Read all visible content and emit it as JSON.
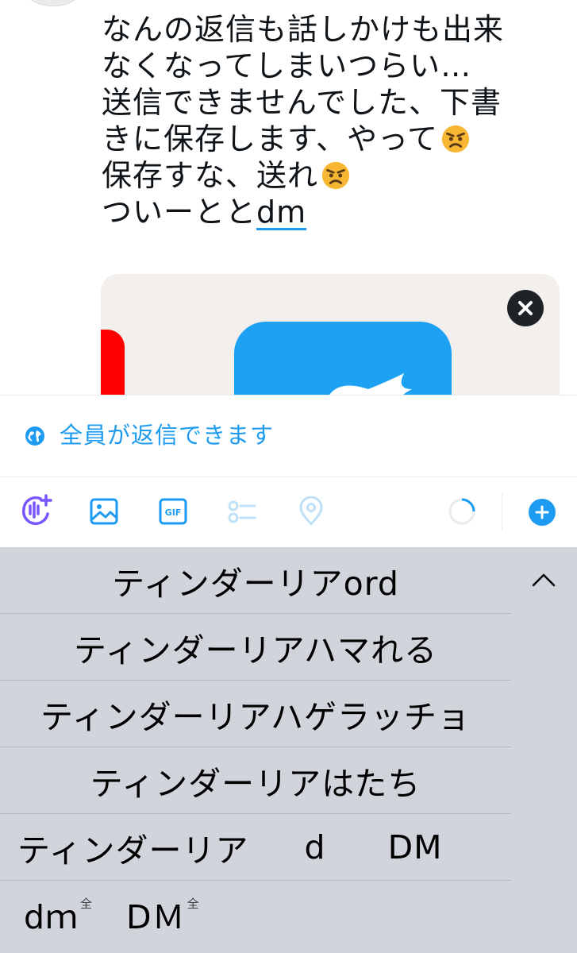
{
  "compose": {
    "lines": [
      {
        "text": "なんの返信も話しかけも出来",
        "emoji": ""
      },
      {
        "text": "なくなってしまいつらい…",
        "emoji": ""
      },
      {
        "text": "送信できませんでした、下書",
        "emoji": ""
      },
      {
        "text": "きに保存します、やって",
        "emoji": "angry-face-emoji"
      },
      {
        "text": "保存すな、送れ",
        "emoji": "angry-face-emoji"
      }
    ],
    "last_line_prefix": "ついーとと",
    "last_line_underlined": "dm"
  },
  "reply_settings": {
    "icon": "globe-icon",
    "label": "全員が返信できます"
  },
  "toolbar": {
    "icons": [
      "voice-tweet-icon",
      "image-icon",
      "gif-icon",
      "poll-icon",
      "location-icon",
      "character-counter",
      "add-tweet-icon"
    ],
    "gif_label": "GIF",
    "accent_color": "#1d9bf0",
    "disabled_color": "#bfe0f7",
    "voice_color": "#7856ff",
    "character_progress": 0.3
  },
  "keyboard": {
    "candidates": [
      {
        "text": "ティンダーリアord"
      },
      {
        "text": "ティンダーリアハマれる"
      },
      {
        "text": "ティンダーリアハゲラッチョ"
      },
      {
        "text": "ティンダーリアはたち"
      }
    ],
    "split_row": [
      "ティンダーリア",
      "d",
      "DM"
    ],
    "last_row": [
      {
        "text": "dｍ",
        "badge": "全"
      },
      {
        "text": "DＭ",
        "badge": "全"
      }
    ],
    "collapse_icon": "chevron-up-icon"
  }
}
